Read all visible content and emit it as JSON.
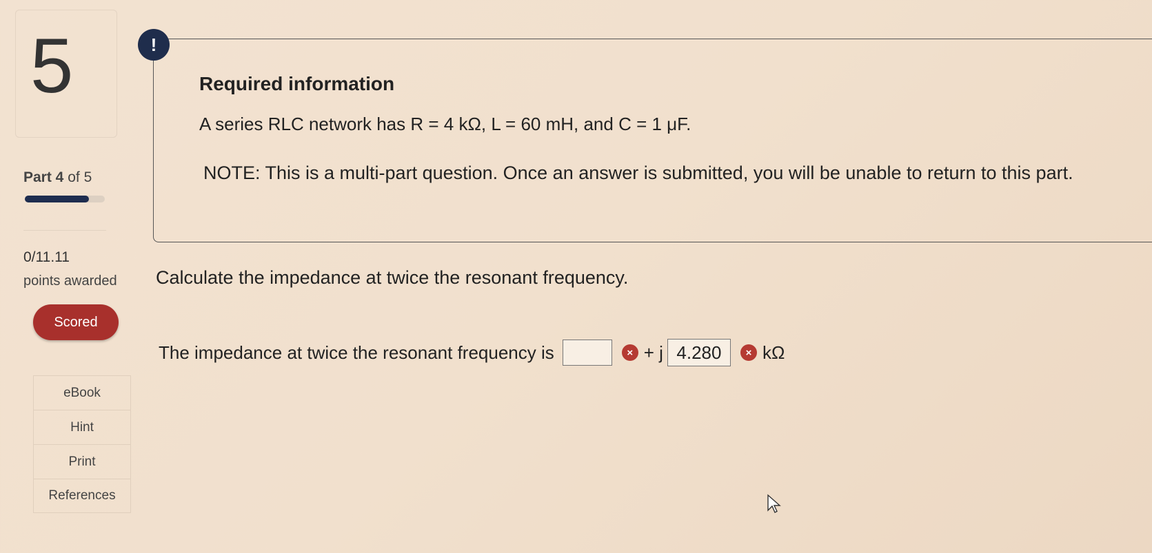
{
  "question": {
    "number": "5"
  },
  "progress": {
    "part_text_bold": "Part 4",
    "part_text_rest": "of 5",
    "fraction": 0.8
  },
  "score": {
    "points": "0/11.11",
    "label": "points awarded",
    "badge": "Scored"
  },
  "tools": [
    "eBook",
    "Hint",
    "Print",
    "References"
  ],
  "info": {
    "alert_symbol": "!",
    "title": "Required information",
    "problem": "A series RLC network has R = 4 kΩ, L = 60 mH, and C = 1 μF.",
    "note": "NOTE: This is a multi-part question. Once an answer is submitted, you will be unable to return to this part."
  },
  "prompt": "Calculate the impedance at twice the resonant frequency.",
  "answer": {
    "lead": "The impedance at twice the resonant frequency is",
    "real_value": "",
    "plus_j": "+ j",
    "imag_value": "4.280",
    "unit": "kΩ",
    "error_symbol": "×"
  }
}
